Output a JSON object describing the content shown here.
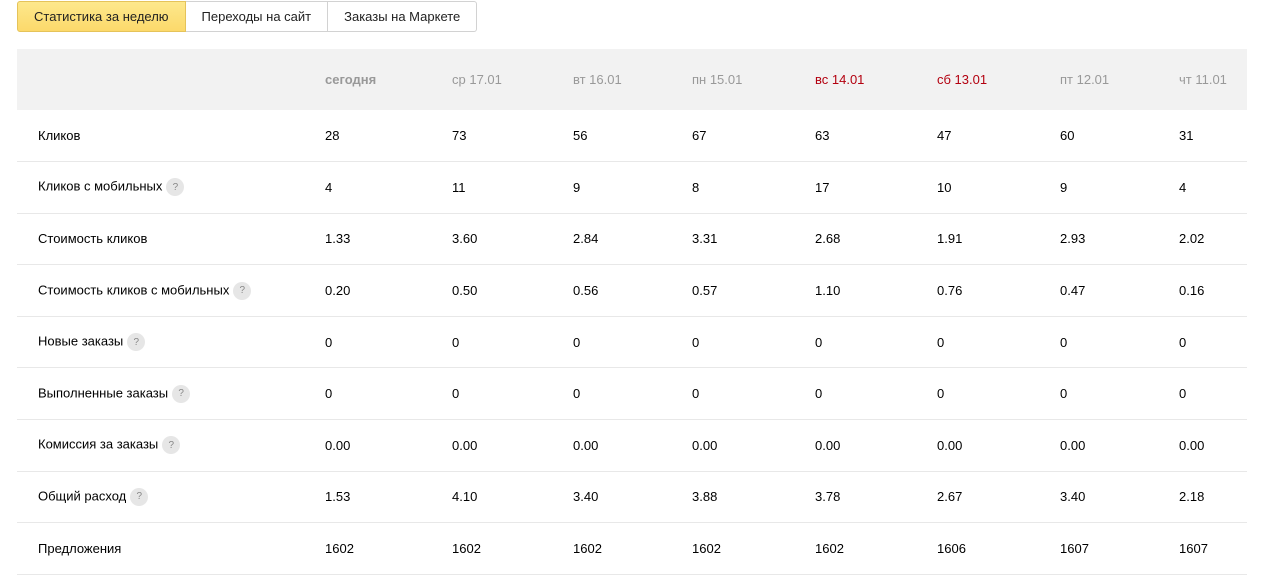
{
  "tabs": [
    {
      "label": "Статистика за неделю",
      "active": true
    },
    {
      "label": "Переходы на сайт",
      "active": false
    },
    {
      "label": "Заказы на Маркете",
      "active": false
    }
  ],
  "help_glyph": "?",
  "columns": [
    {
      "label": "сегодня",
      "today": true,
      "weekend": false
    },
    {
      "label": "ср 17.01",
      "today": false,
      "weekend": false
    },
    {
      "label": "вт 16.01",
      "today": false,
      "weekend": false
    },
    {
      "label": "пн 15.01",
      "today": false,
      "weekend": false
    },
    {
      "label": "вс 14.01",
      "today": false,
      "weekend": true
    },
    {
      "label": "сб 13.01",
      "today": false,
      "weekend": true
    },
    {
      "label": "пт 12.01",
      "today": false,
      "weekend": false
    },
    {
      "label": "чт 11.01",
      "today": false,
      "weekend": false
    }
  ],
  "rows": [
    {
      "label": "Кликов",
      "help": false,
      "values": [
        "28",
        "73",
        "56",
        "67",
        "63",
        "47",
        "60",
        "31"
      ]
    },
    {
      "label": "Кликов с мобильных",
      "help": true,
      "values": [
        "4",
        "11",
        "9",
        "8",
        "17",
        "10",
        "9",
        "4"
      ]
    },
    {
      "label": "Стоимость кликов",
      "help": false,
      "values": [
        "1.33",
        "3.60",
        "2.84",
        "3.31",
        "2.68",
        "1.91",
        "2.93",
        "2.02"
      ]
    },
    {
      "label": "Стоимость кликов с мобильных",
      "help": true,
      "values": [
        "0.20",
        "0.50",
        "0.56",
        "0.57",
        "1.10",
        "0.76",
        "0.47",
        "0.16"
      ]
    },
    {
      "label": "Новые заказы",
      "help": true,
      "values": [
        "0",
        "0",
        "0",
        "0",
        "0",
        "0",
        "0",
        "0"
      ]
    },
    {
      "label": "Выполненные заказы",
      "help": true,
      "values": [
        "0",
        "0",
        "0",
        "0",
        "0",
        "0",
        "0",
        "0"
      ]
    },
    {
      "label": "Комиссия за заказы",
      "help": true,
      "values": [
        "0.00",
        "0.00",
        "0.00",
        "0.00",
        "0.00",
        "0.00",
        "0.00",
        "0.00"
      ]
    },
    {
      "label": "Общий расход",
      "help": true,
      "values": [
        "1.53",
        "4.10",
        "3.40",
        "3.88",
        "3.78",
        "2.67",
        "3.40",
        "2.18"
      ]
    },
    {
      "label": "Предложения",
      "help": false,
      "values": [
        "1602",
        "1602",
        "1602",
        "1602",
        "1602",
        "1606",
        "1607",
        "1607"
      ]
    }
  ],
  "colors": {
    "active_tab": "#fcd96b",
    "header_bg": "#f2f2f2",
    "weekend_text": "#b3000f",
    "header_text": "#999999"
  }
}
